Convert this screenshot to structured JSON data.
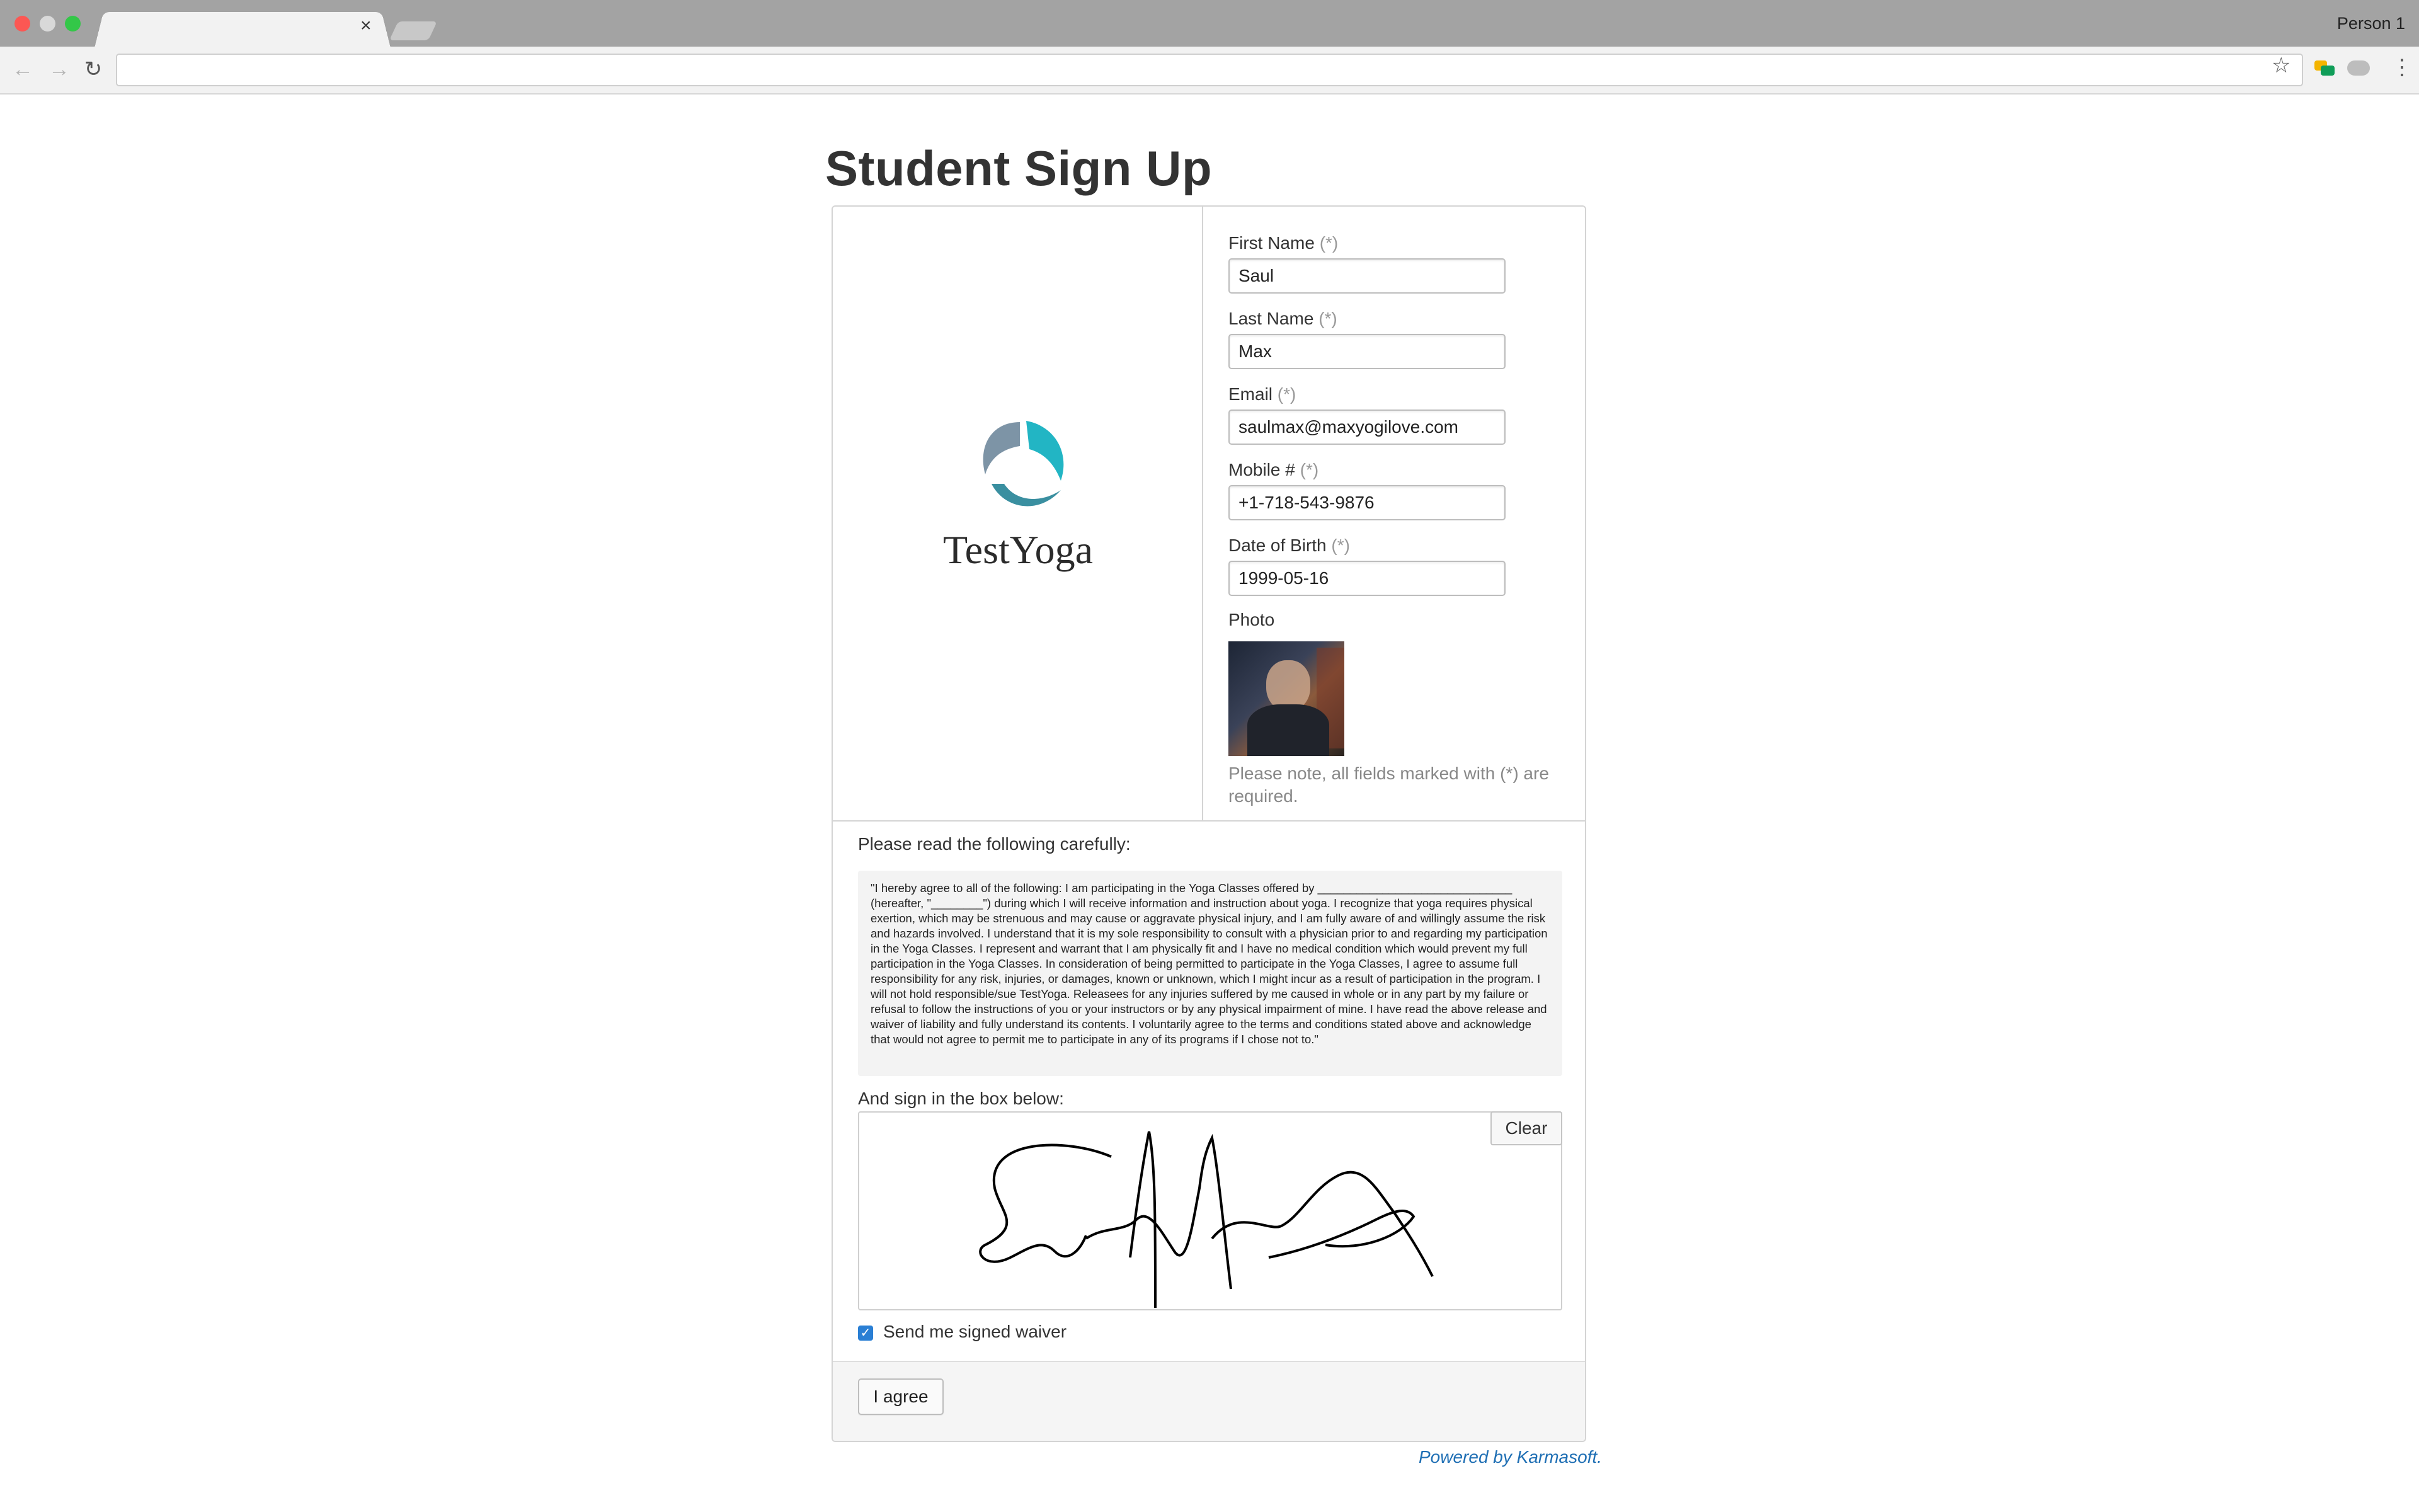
{
  "browser": {
    "profile_name": "Person 1",
    "tab_close_glyph": "×",
    "url": ""
  },
  "page": {
    "title": "Student Sign Up"
  },
  "logo": {
    "brand_name": "TestYoga",
    "colors": {
      "grey_arc": "#7d94a6",
      "teal_arc": "#22b5c4",
      "dark_teal": "#3a8fa0"
    }
  },
  "form": {
    "required_marker": "(*)",
    "fields": [
      {
        "label": "First Name",
        "value": "Saul"
      },
      {
        "label": "Last Name",
        "value": "Max"
      },
      {
        "label": "Email",
        "value": "saulmax@maxyogilove.com"
      },
      {
        "label": "Mobile #",
        "value": "+1-718-543-9876"
      },
      {
        "label": "Date of Birth",
        "value": "1999-05-16"
      }
    ],
    "photo_label": "Photo",
    "note": "Please note, all fields marked with (*) are required."
  },
  "waiver": {
    "read_label": "Please read the following carefully:",
    "text": "\"I hereby agree to all of the following: I am participating in the Yoga Classes offered by ______________________________ (hereafter, \"________\") during which I will receive information and instruction about yoga. I recognize that yoga requires physical exertion, which may be strenuous and may cause or aggravate physical injury, and I am fully aware of and willingly assume the risk and hazards involved. I understand that it is my sole responsibility to consult with a physician prior to and regarding my participation in the Yoga Classes. I represent and warrant that I am physically fit and I have no medical condition which would prevent my full participation in the Yoga Classes. In consideration of being permitted to participate in the Yoga Classes, I agree to assume full responsibility for any risk, injuries, or damages, known or unknown, which I might incur as a result of participation in the program. I will not hold responsible/sue TestYoga. Releasees for any injuries suffered by me caused in whole or in any part by my failure or refusal to follow the instructions of you or your instructors or by any physical impairment of mine. I have read the above release and waiver of liability and fully understand its contents. I voluntarily agree to the terms and conditions stated above and acknowledge that would not agree to permit me to participate in any of its programs if I chose not to.\"",
    "sign_label": "And sign in the box below:",
    "clear_label": "Clear",
    "send_copy_label": "Send me signed waiver",
    "send_copy_checked": true,
    "agree_label": "I agree"
  },
  "footer": {
    "powered_by": "Powered by Karmasoft."
  }
}
